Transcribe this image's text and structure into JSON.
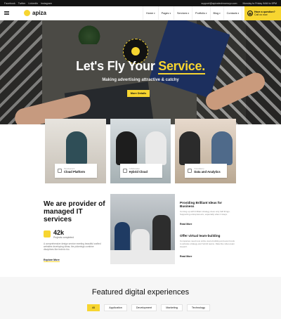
{
  "topbar": {
    "socials": [
      "Facebook",
      "Twitter",
      "LinkedIn",
      "Instagram"
    ],
    "email": "support@apizatechnomcyv.com",
    "hours": "Monday to Friday 9AM to 5PM"
  },
  "header": {
    "logo_text": "apiza",
    "nav": [
      "Home",
      "Pages",
      "Services",
      "Portfolio",
      "Blog",
      "Contacts"
    ],
    "cta_line1": "Have a question?",
    "cta_line2": "Call us now"
  },
  "hero": {
    "title_main": "Let's Fly Your ",
    "title_accent": "Service",
    "title_end": ".",
    "subtitle": "Making advertising attractive & catchy",
    "button": "More Details"
  },
  "cards": [
    {
      "small": "Development",
      "main": "Cloud Platform"
    },
    {
      "small": "Collaboration",
      "main": "Hybrid Cloud"
    },
    {
      "small": "Consultancy",
      "main": "Data and Analytics"
    }
  ],
  "about": {
    "title": "We are provider of managed IT services",
    "stat_value": "42k",
    "stat_label": "Projects completed",
    "paragraph": "A comprehensive design service meeting beautiful crafted websites developing ideas; the pickerings combine disciplines like technic bio.",
    "link": "Explore More"
  },
  "features": [
    {
      "title": "Providing Brilliant Ideas for Business",
      "text": "Coming up with brilliant strategy does only half things. Supporting entrepreneurs, especially when it stays.",
      "link": "Read More"
    },
    {
      "title": "Offer virtual team-building",
      "text": "Companies need new online team-building and event tools to activate strategy and hybrid teams. Data like video-team support.",
      "link": "Read More"
    }
  ],
  "featured": {
    "title": "Featured digital experiences",
    "tabs": [
      "All",
      "Application",
      "Development",
      "Marketing",
      "Technology"
    ]
  },
  "colors": {
    "accent": "#f7d530",
    "dark": "#121212"
  }
}
